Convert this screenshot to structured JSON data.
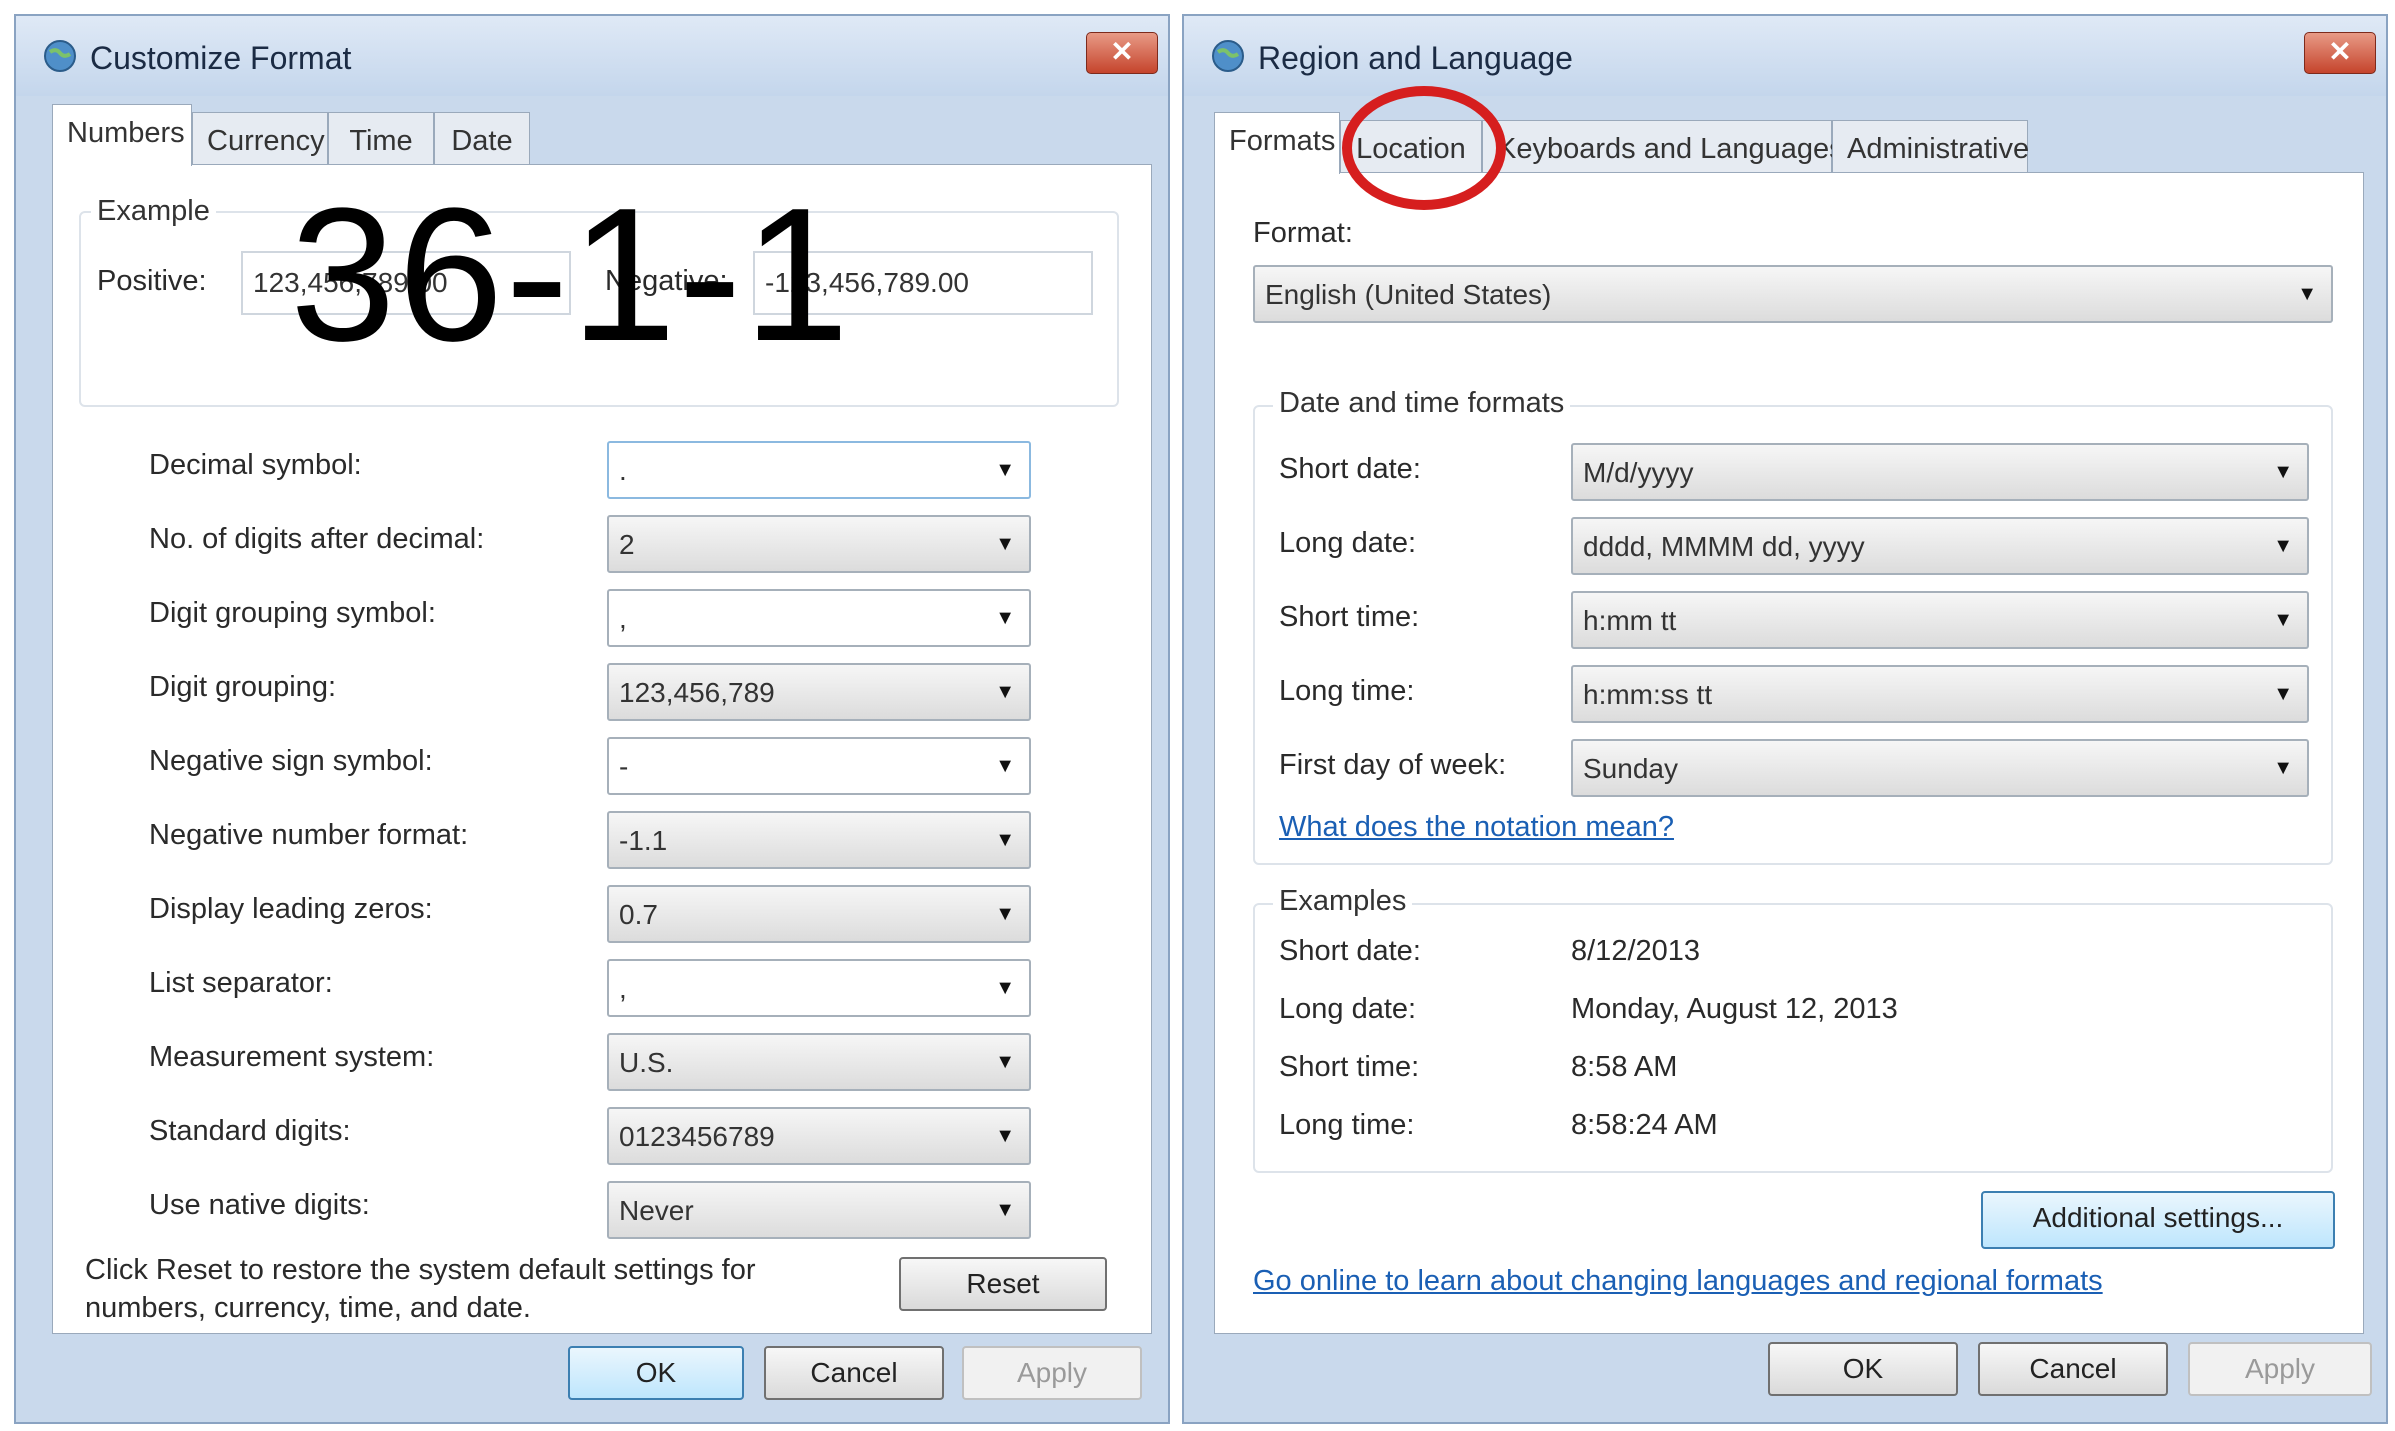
{
  "overlay_text": "36-1-1",
  "customize_format": {
    "title": "Customize Format",
    "tabs": [
      "Numbers",
      "Currency",
      "Time",
      "Date"
    ],
    "example": {
      "group_label": "Example",
      "positive_label": "Positive:",
      "positive_value": "123,456,789.00",
      "negative_label": "Negative:",
      "negative_value": "-123,456,789.00"
    },
    "fields": [
      {
        "label": "Decimal symbol:",
        "value": "."
      },
      {
        "label": "No. of digits after decimal:",
        "value": "2"
      },
      {
        "label": "Digit grouping symbol:",
        "value": ","
      },
      {
        "label": "Digit grouping:",
        "value": "123,456,789"
      },
      {
        "label": "Negative sign symbol:",
        "value": "-"
      },
      {
        "label": "Negative number format:",
        "value": "-1.1"
      },
      {
        "label": "Display leading zeros:",
        "value": "0.7"
      },
      {
        "label": "List separator:",
        "value": ","
      },
      {
        "label": "Measurement system:",
        "value": "U.S."
      },
      {
        "label": "Standard digits:",
        "value": "0123456789"
      },
      {
        "label": "Use native digits:",
        "value": "Never"
      }
    ],
    "reset_hint": "Click Reset to restore the system default settings for numbers, currency, time, and date.",
    "reset_button": "Reset",
    "ok_button": "OK",
    "cancel_button": "Cancel",
    "apply_button": "Apply"
  },
  "region_language": {
    "title": "Region and Language",
    "tabs": [
      "Formats",
      "Location",
      "Keyboards and Languages",
      "Administrative"
    ],
    "format_label": "Format:",
    "format_value": "English (United States)",
    "date_time_group": "Date and time formats",
    "date_time_fields": [
      {
        "label": "Short date:",
        "value": "M/d/yyyy"
      },
      {
        "label": "Long date:",
        "value": "dddd, MMMM dd, yyyy"
      },
      {
        "label": "Short time:",
        "value": "h:mm tt"
      },
      {
        "label": "Long time:",
        "value": "h:mm:ss tt"
      },
      {
        "label": "First day of week:",
        "value": "Sunday"
      }
    ],
    "notation_link": "What does the notation mean?",
    "examples_group": "Examples",
    "examples": [
      {
        "label": "Short date:",
        "value": "8/12/2013"
      },
      {
        "label": "Long date:",
        "value": "Monday, August 12, 2013"
      },
      {
        "label": "Short time:",
        "value": "8:58 AM"
      },
      {
        "label": "Long time:",
        "value": "8:58:24 AM"
      }
    ],
    "additional_settings_button": "Additional settings...",
    "online_link": "Go online to learn about changing languages and regional formats",
    "ok_button": "OK",
    "cancel_button": "Cancel",
    "apply_button": "Apply"
  },
  "colors": {
    "highlight_circle": "#d61e1e",
    "link": "#1a5fb4",
    "window_frame": "#c9d9ec"
  }
}
